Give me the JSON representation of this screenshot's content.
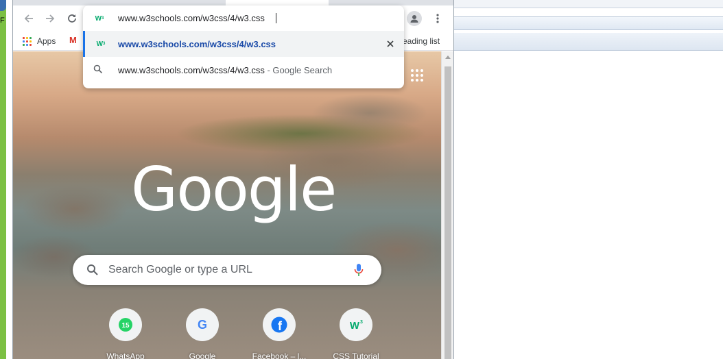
{
  "background_window": {
    "left_letter": "F"
  },
  "browser": {
    "bookmarks_bar": {
      "apps_label": "Apps",
      "gmail_label": "M",
      "reading_list_label": "eading list"
    },
    "omnibox": {
      "input_value": "www.w3schools.com/w3css/4/w3.css",
      "suggestions": [
        {
          "text": "www.w3schools.com/w3css/4/w3.css",
          "icon": "w3schools-icon"
        },
        {
          "text": "www.w3schools.com/w3css/4/w3.css",
          "description": "- Google Search",
          "icon": "search-icon"
        }
      ]
    },
    "new_tab_page": {
      "logo": "Google",
      "search_placeholder": "Search Google or type a URL",
      "shortcuts": [
        {
          "label": "WhatsApp",
          "badge": "15",
          "icon": "whatsapp-icon"
        },
        {
          "label": "Google",
          "icon": "google-icon"
        },
        {
          "label": "Facebook – l...",
          "icon": "facebook-icon"
        },
        {
          "label": "CSS Tutorial",
          "icon": "w3schools-icon"
        }
      ]
    }
  },
  "colors": {
    "accent": "#1a73e8",
    "w3_green": "#04aa6d",
    "gmail_red": "#d93025",
    "facebook_blue": "#1877f2",
    "whatsapp_green": "#25d366"
  }
}
